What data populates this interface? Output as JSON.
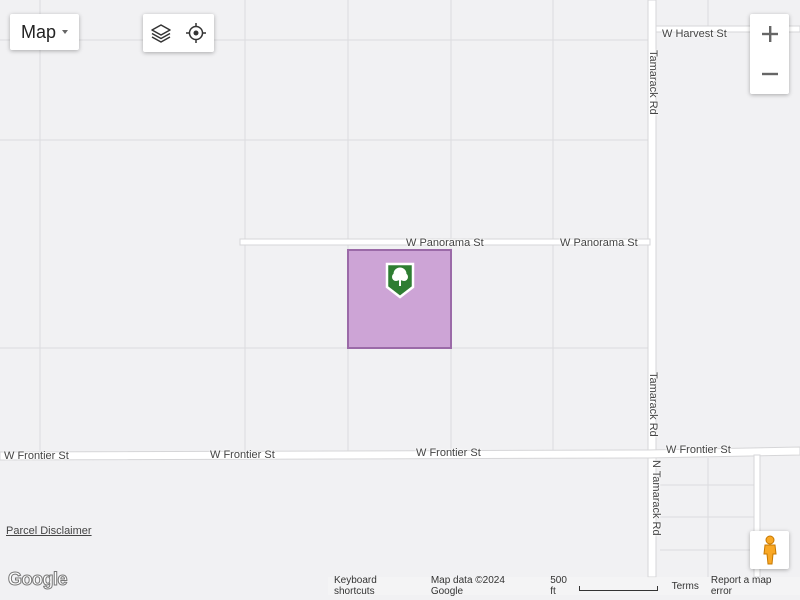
{
  "map_type": {
    "label": "Map"
  },
  "streets": {
    "harvest": "W Harvest St",
    "tamarack_north": "Tamarack Rd",
    "tamarack_mid": "Tamarack Rd",
    "tamarack_south": "N Tamarack Rd",
    "panorama_1": "W Panorama St",
    "panorama_2": "W Panorama St",
    "frontier_1": "W Frontier St",
    "frontier_2": "W Frontier St",
    "frontier_3": "W Frontier St",
    "frontier_4": "W Frontier St"
  },
  "parcel": {
    "fill_color": "#cda4d6",
    "border_color": "#9b6aa8",
    "marker_color": "#2e7d32",
    "marker_icon": "tree-icon"
  },
  "disclaimer": "Parcel Disclaimer",
  "logo": "Google",
  "footer": {
    "shortcuts": "Keyboard shortcuts",
    "map_data": "Map data ©2024 Google",
    "scale": "500 ft",
    "terms": "Terms",
    "report": "Report a map error"
  },
  "icons": {
    "layers": "layers-icon",
    "locate": "my-location-icon",
    "zoom_in": "plus-icon",
    "zoom_out": "minus-icon",
    "street_view": "pegman-icon"
  }
}
